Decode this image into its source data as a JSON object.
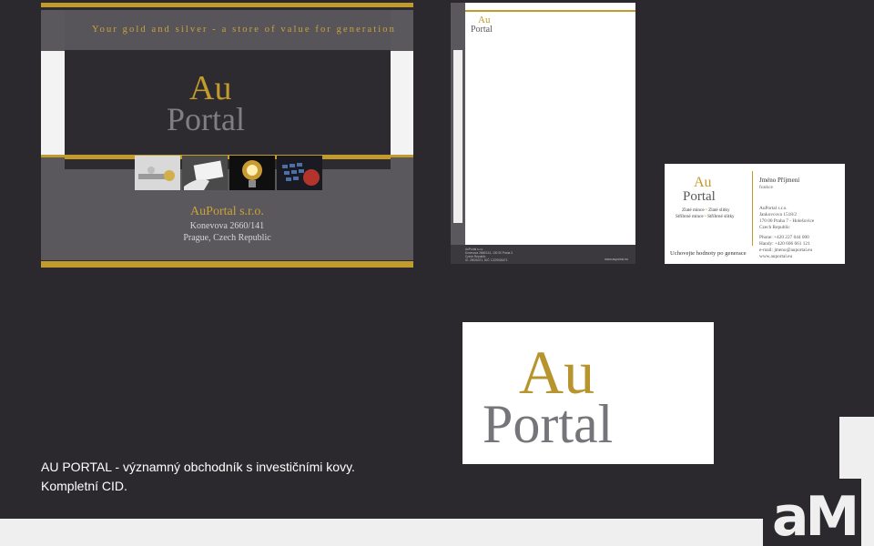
{
  "brand": {
    "logo_top": "Au",
    "logo_bottom": "Portal",
    "gold": "#c19b2c",
    "grey": "#807f84",
    "dark": "#2b292d"
  },
  "folder": {
    "tagline": "Your gold and silver - a store of value for generation",
    "company": "AuPortal s.r.o.",
    "street": "Konevova 2660/141",
    "city": "Prague, Czech Republic",
    "photo_icons": [
      "metal-balls-photo",
      "hand-card-photo",
      "light-bulb-photo",
      "keyboard-photo"
    ]
  },
  "letterhead": {
    "footer_lines": "AuPortal s.r.o.\nKonevova 2660/141, 130 00 Praha 3\nCzech Republic\nIČ: 29026471, DIČ: CZ29026471",
    "url": "www.auportal.eu"
  },
  "card": {
    "name": "Jméno Příjmení",
    "role": "funkce",
    "products_row1_a": "Zlaté mince",
    "products_row1_b": "Zlaté slitky",
    "products_row2_a": "Stříbrné mince",
    "products_row2_b": "Stříbrné slitky",
    "slogan": "Uchovejte hodnoty po generace",
    "company": "AuPortal s.r.o.",
    "street": "Jankovcova 1518/2",
    "city": "170 00 Praha 7 - Holešovice",
    "country": "Czech Republic",
    "phone": "Phone: +420 227 044 000",
    "handy": "Handy: +420 606 661 121",
    "email": "e-mail: jmeno@auportal.eu",
    "web": "www.auportal.eu"
  },
  "caption": {
    "line1": "AU PORTAL - významný obchodník s investičními kovy.",
    "line2": "Kompletní CID."
  },
  "badge": {
    "label": "aM"
  }
}
